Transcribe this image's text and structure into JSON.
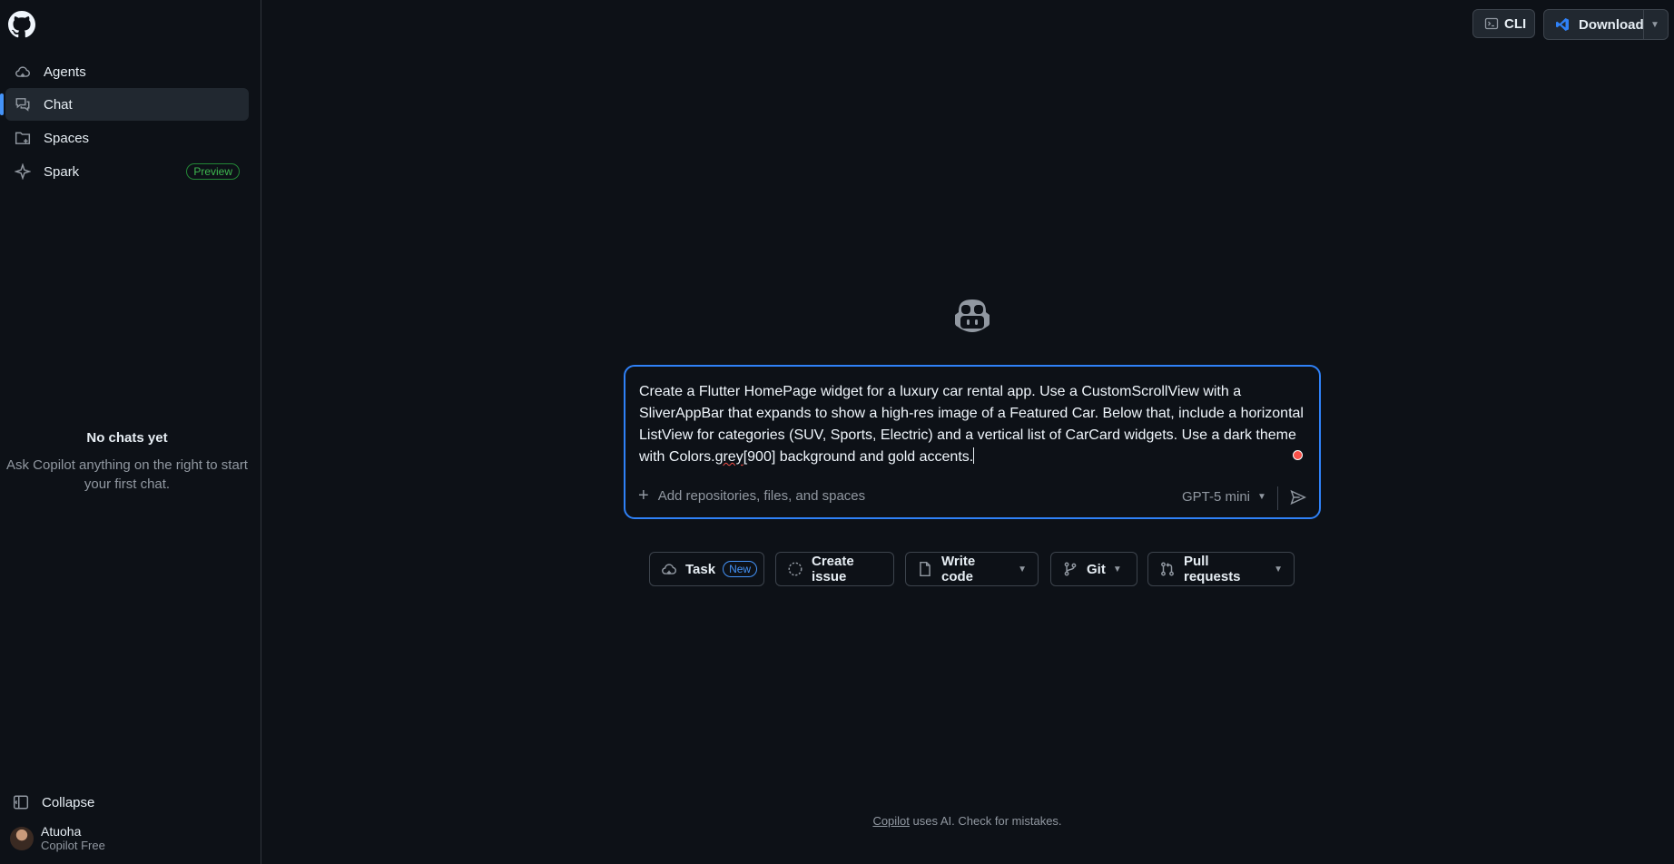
{
  "sidebar": {
    "logo": "github-logo",
    "items": [
      {
        "label": "Agents",
        "icon": "cloud-icon"
      },
      {
        "label": "Chat",
        "icon": "chat-icon",
        "active": true
      },
      {
        "label": "Spaces",
        "icon": "spaces-icon"
      },
      {
        "label": "Spark",
        "icon": "spark-icon",
        "badge": "Preview"
      }
    ],
    "empty_title": "No chats yet",
    "empty_desc": "Ask Copilot anything on the right to start your first chat.",
    "collapse_label": "Collapse",
    "user": {
      "name": "Atuoha",
      "plan": "Copilot Free"
    }
  },
  "header": {
    "cli_label": "CLI",
    "download_label": "Download"
  },
  "composer": {
    "text_before": "Create a Flutter HomePage widget for a luxury car rental app. Use a CustomScrollView with a SliverAppBar that expands to show a high-res image of a Featured Car. Below that, include a horizontal ListView for categories (SUV, Sports, Electric) and a vertical list of CarCard widgets. Use a dark theme with Colors.",
    "text_misspelled": "grey",
    "text_after": "[900] background and gold accents.",
    "add_context_label": "Add repositories, files, and spaces",
    "model": "GPT-5 mini"
  },
  "actions": [
    {
      "label": "Task",
      "icon": "cloud-icon",
      "badge": "New"
    },
    {
      "label": "Create issue",
      "icon": "issue-circle-icon"
    },
    {
      "label": "Write code",
      "icon": "file-icon",
      "dropdown": true
    },
    {
      "label": "Git",
      "icon": "git-branch-icon",
      "dropdown": true
    },
    {
      "label": "Pull requests",
      "icon": "pull-request-icon",
      "dropdown": true
    }
  ],
  "footer": {
    "link": "Copilot",
    "text": "uses AI. Check for mistakes."
  },
  "colors": {
    "background": "#0d1117",
    "accent": "#2f81f7",
    "preview_badge": "#3fb950"
  }
}
